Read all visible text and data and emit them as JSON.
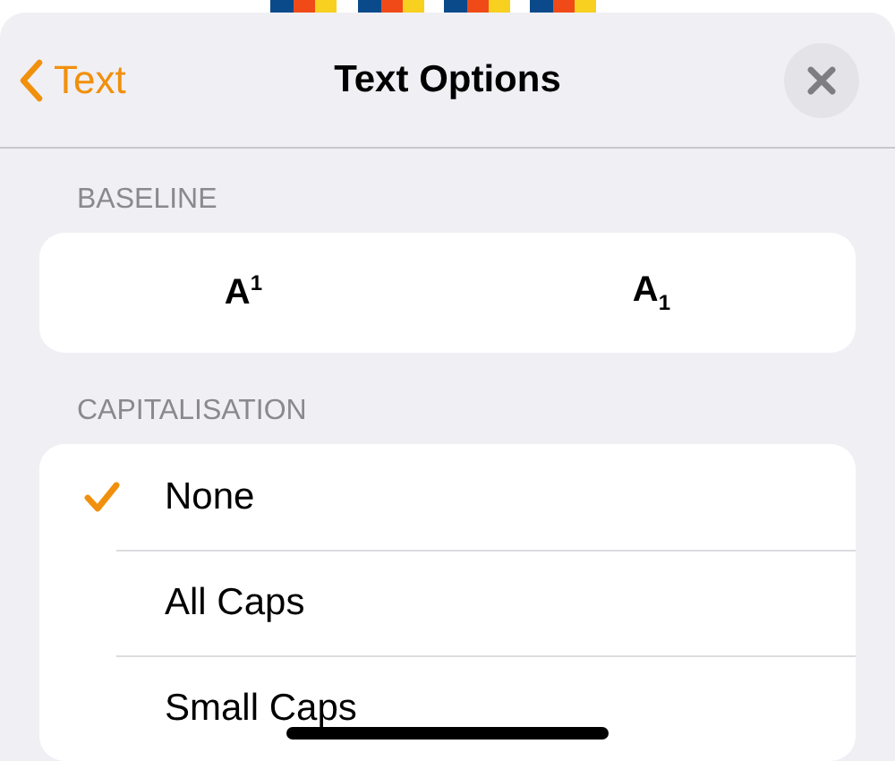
{
  "nav": {
    "back_label": "Text",
    "title": "Text Options"
  },
  "baseline": {
    "header": "BASELINE",
    "options": [
      {
        "label": "A$^{1}$"
      },
      {
        "label": "A$_{1}$"
      }
    ]
  },
  "capitalisation": {
    "header": "CAPITALISATION",
    "options": [
      {
        "label": "None",
        "selected": true
      },
      {
        "label": "All Caps",
        "selected": false
      },
      {
        "label": "Small Caps",
        "selected": false
      }
    ]
  }
}
